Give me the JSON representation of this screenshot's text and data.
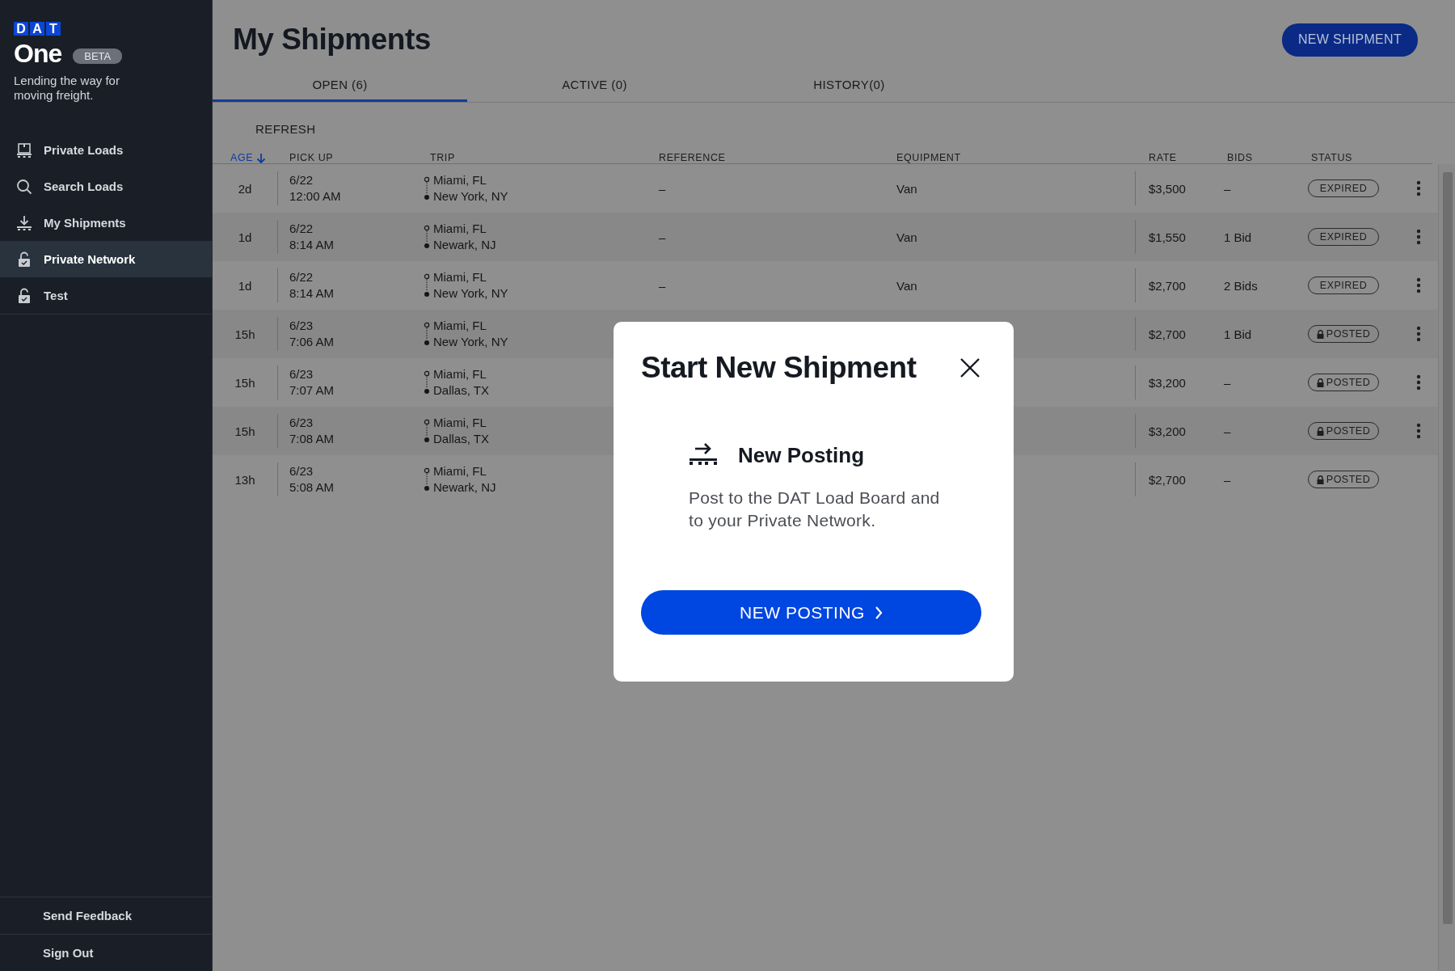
{
  "sidebar": {
    "logo_letters": [
      "D",
      "A",
      "T"
    ],
    "product": "One",
    "badge": "BETA",
    "tagline": "Lending the way for moving freight.",
    "items": [
      {
        "label": "Private Loads",
        "kind": "pallet",
        "selected": false
      },
      {
        "label": "Search Loads",
        "kind": "search",
        "selected": false
      },
      {
        "label": "My Shipments",
        "kind": "download",
        "selected": false
      },
      {
        "label": "Private Network",
        "kind": "lock",
        "selected": true
      },
      {
        "label": "Test",
        "kind": "lock",
        "selected": false
      }
    ],
    "footer": [
      "Send Feedback",
      "Sign Out"
    ]
  },
  "page": {
    "title": "My Shipments",
    "new_button": "NEW SHIPMENT"
  },
  "tabs": [
    {
      "label": "OPEN (6)",
      "selected": true
    },
    {
      "label": "ACTIVE (0)",
      "selected": false
    },
    {
      "label": "HISTORY(0)",
      "selected": false
    }
  ],
  "refresh": "REFRESH",
  "table": {
    "columns": [
      {
        "label": "AGE",
        "sorted": true
      },
      {
        "label": "PICK UP",
        "sorted": false
      },
      {
        "label": "TRIP",
        "sorted": false
      },
      {
        "label": "REFERENCE",
        "sorted": false
      },
      {
        "label": "EQUIPMENT",
        "sorted": false
      },
      {
        "label": "RATE",
        "sorted": false
      },
      {
        "label": "BIDS",
        "sorted": false
      },
      {
        "label": "STATUS",
        "sorted": false
      }
    ],
    "rows": [
      {
        "age": "2d",
        "date": "6/22",
        "time": "12:00 AM",
        "origin": "Miami, FL",
        "destination": "New York, NY",
        "reference": "–",
        "equipment": "Van",
        "rate": "$3,500",
        "bids": "–",
        "status": {
          "label": "EXPIRED",
          "kind": "expired"
        },
        "menu": true
      },
      {
        "age": "1d",
        "date": "6/22",
        "time": "8:14 AM",
        "origin": "Miami, FL",
        "destination": "Newark, NJ",
        "reference": "–",
        "equipment": "Van",
        "rate": "$1,550",
        "bids": "1 Bid",
        "status": {
          "label": "EXPIRED",
          "kind": "expired"
        },
        "menu": true
      },
      {
        "age": "1d",
        "date": "6/22",
        "time": "8:14 AM",
        "origin": "Miami, FL",
        "destination": "New York, NY",
        "reference": "–",
        "equipment": "Van",
        "rate": "$2,700",
        "bids": "2 Bids",
        "status": {
          "label": "EXPIRED",
          "kind": "expired"
        },
        "menu": true
      },
      {
        "age": "15h",
        "date": "6/23",
        "time": "7:06 AM",
        "origin": "Miami, FL",
        "destination": "New York, NY",
        "rate": "$2,700",
        "bids": "1 Bid",
        "status": {
          "label": "POSTED",
          "kind": "posted"
        },
        "menu": true
      },
      {
        "age": "15h",
        "date": "6/23",
        "time": "7:07 AM",
        "origin": "Miami, FL",
        "destination": "Dallas, TX",
        "rate": "$3,200",
        "bids": "–",
        "status": {
          "label": "POSTED",
          "kind": "posted"
        },
        "menu": true
      },
      {
        "age": "15h",
        "date": "6/23",
        "time": "7:08 AM",
        "origin": "Miami, FL",
        "destination": "Dallas, TX",
        "rate": "$3,200",
        "bids": "–",
        "status": {
          "label": "POSTED",
          "kind": "posted"
        },
        "menu": true
      },
      {
        "age": "13h",
        "date": "6/23",
        "time": "5:08 AM",
        "origin": "Miami, FL",
        "destination": "Newark, NJ",
        "rate": "$2,700",
        "bids": "–",
        "status": {
          "label": "POSTED",
          "kind": "posted"
        },
        "menu": false
      }
    ]
  },
  "modal": {
    "title": "Start New Shipment",
    "option_title": "New Posting",
    "option_text": "Post to the DAT Load Board and to your Private Network.",
    "button": "NEW POSTING"
  }
}
